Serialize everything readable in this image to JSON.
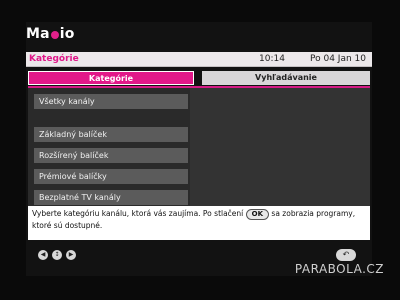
{
  "app": {
    "logo": "Magio"
  },
  "header": {
    "title": "Kategórie",
    "time": "10:14",
    "date": "Po 04 Jan 10"
  },
  "tabs": [
    {
      "label": "Kategórie",
      "active": true
    },
    {
      "label": "Vyhľadávanie",
      "active": false
    }
  ],
  "categories": [
    "Všetky kanály",
    "Základný balíček",
    "Rozšírený balíček",
    "Prémiové balíčky",
    "Bezplatné TV kanály"
  ],
  "info": {
    "text_before": "Vyberte kategóriu kanálu, ktorá vás zaujíma. Po stlačení",
    "ok_label": "OK",
    "text_after": "sa zobrazia programy, ktoré sú dostupné."
  },
  "footer": {
    "nav_icons": [
      "left-arrow-icon",
      "up-down-icon",
      "right-arrow-icon"
    ],
    "back_icon": "back-icon"
  },
  "watermark": "PARABOLA.CZ",
  "colors": {
    "accent": "#e21889",
    "item_bg": "#5b5b5b",
    "header_bg": "#ece8ea"
  }
}
